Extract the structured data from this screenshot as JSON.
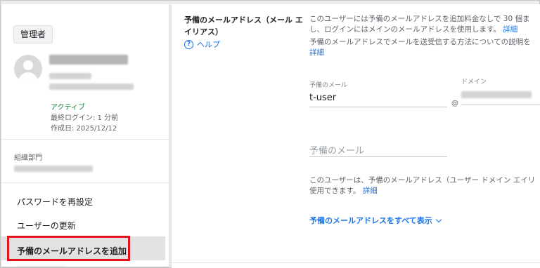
{
  "left_card": {
    "role_chip": "管理者",
    "status": "アクティブ",
    "last_login": "最終ログイン: 1 分前",
    "created": "作成日: 2025/12/12",
    "org_unit_label": "組織部門",
    "menu": {
      "reset_password": "パスワードを再設定",
      "update_user": "ユーザーの更新",
      "add_alias": "予備のメールアドレスを追加"
    }
  },
  "right_panel": {
    "section_title": "予備のメールアドレス（メール エイリアス）",
    "help_label": "ヘルプ",
    "desc1_line1": "このユーザーには予備のメールアドレスを追加料金なしで 30 個ま",
    "desc1_line2": "し、ログインにはメインのメールアドレスを使用します。",
    "desc1_link": "詳細",
    "desc2_line1": "予備のメールアドレスでメールを送受信する方法についての説明を",
    "desc2_link": "詳細",
    "alias_field_label": "予備のメール",
    "alias_field_value": "t-user",
    "at_sign": "@",
    "domain_label": "ドメイン",
    "alias_placeholder": "予備のメール",
    "desc3_line1": "このユーザーは、予備のメールアドレス（ユーザー ドメイン エイリ",
    "desc3_line2": "使用できます。",
    "desc3_link": "詳細",
    "show_all": "予備のメールアドレスをすべて表示"
  },
  "colors": {
    "accent_link": "#1a73e8",
    "status_active": "#188038",
    "highlight_border": "#e3121b"
  }
}
